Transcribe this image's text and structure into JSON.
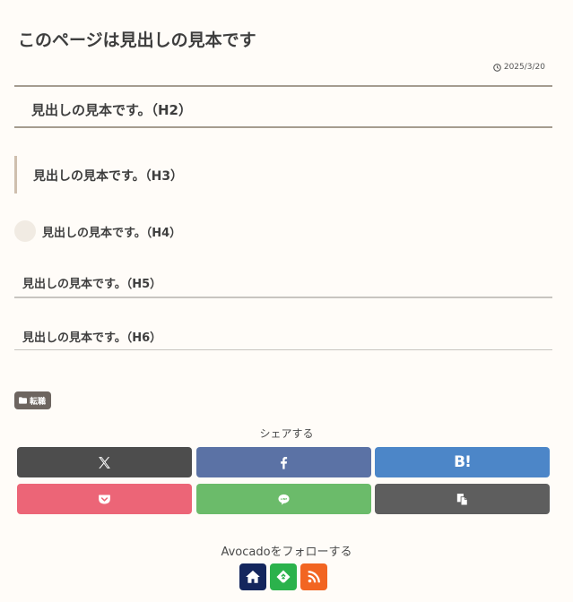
{
  "page": {
    "title": "このページは見出しの見本です",
    "date": "2025/3/20"
  },
  "headings": {
    "h2": "見出しの見本です。（H2）",
    "h3": "見出しの見本です。（H3）",
    "h4": "見出しの見本です。（H4）",
    "h5": "見出しの見本です。（H5）",
    "h6": "見出しの見本です。（H6）"
  },
  "category_tag": {
    "label": "転職",
    "icon": "folder-icon"
  },
  "share": {
    "title": "シェアする",
    "buttons": [
      {
        "name": "x",
        "icon": "x-logo-icon",
        "color": "#4d4d4d"
      },
      {
        "name": "facebook",
        "icon": "facebook-icon",
        "color": "#5b72a5"
      },
      {
        "name": "hatena",
        "label": "B!",
        "icon": "hatena-bookmark-icon",
        "color": "#4c86c8"
      },
      {
        "name": "pocket",
        "icon": "pocket-icon",
        "color": "#ec6577"
      },
      {
        "name": "line",
        "icon": "line-icon",
        "color": "#6bbb6a"
      },
      {
        "name": "copy",
        "icon": "copy-icon",
        "color": "#5e5e5e"
      }
    ]
  },
  "follow": {
    "title": "Avocadoをフォローする",
    "buttons": [
      {
        "name": "home",
        "icon": "home-icon",
        "color": "#14265d"
      },
      {
        "name": "feedly",
        "icon": "feedly-icon",
        "color": "#2bb24c"
      },
      {
        "name": "rss",
        "icon": "rss-icon",
        "color": "#f26522"
      }
    ]
  }
}
